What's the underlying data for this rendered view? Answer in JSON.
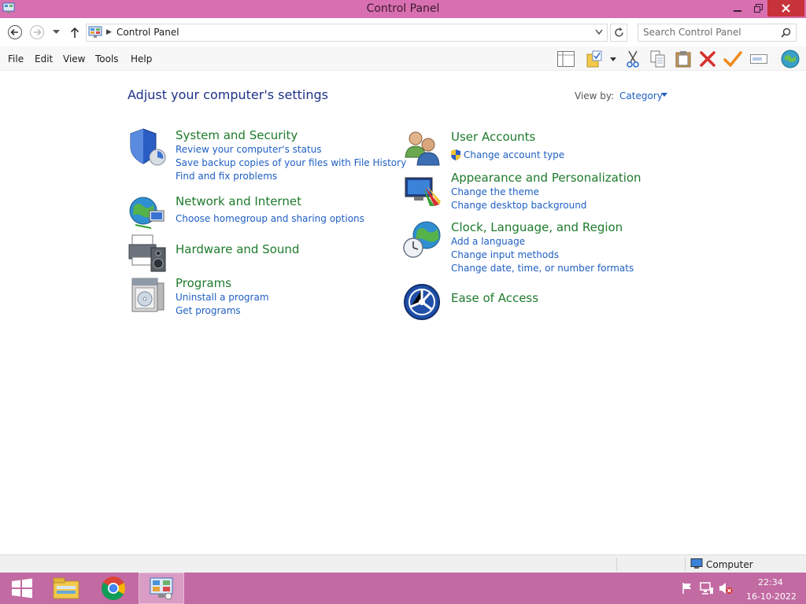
{
  "window": {
    "title": "Control Panel",
    "title_bar_color": "#d86fb0"
  },
  "address_bar": {
    "path": "Control Panel",
    "search_placeholder": "Search Control Panel"
  },
  "menu": {
    "items": [
      "File",
      "Edit",
      "View",
      "Tools",
      "Help"
    ]
  },
  "toolbar": {
    "icons": [
      "layout-pane-icon",
      "properties-folder-icon",
      "cut-icon",
      "copy-icon",
      "paste-icon",
      "delete-icon",
      "check-icon",
      "rename-icon",
      "globe-icon"
    ]
  },
  "content": {
    "heading": "Adjust your computer's settings",
    "view_by_label": "View by:",
    "view_by_value": "Category",
    "link_color": "#1e5fc4",
    "title_color": "#1e7a2c",
    "categories": [
      {
        "title": "System and Security",
        "icon": "shield-icon",
        "links": [
          "Review your computer's status",
          "Save backup copies of your files with File History",
          "Find and fix problems"
        ]
      },
      {
        "title": "Network and Internet",
        "icon": "network-globe-icon",
        "links": [
          "Choose homegroup and sharing options"
        ]
      },
      {
        "title": "Hardware and Sound",
        "icon": "printer-speaker-icon",
        "links": []
      },
      {
        "title": "Programs",
        "icon": "programs-box-icon",
        "links": [
          "Uninstall a program",
          "Get programs"
        ]
      },
      {
        "title": "User Accounts",
        "icon": "users-icon",
        "links": [
          "Change account type"
        ]
      },
      {
        "title": "Appearance and Personalization",
        "icon": "monitor-paint-icon",
        "links": [
          "Change the theme",
          "Change desktop background"
        ]
      },
      {
        "title": "Clock, Language, and Region",
        "icon": "clock-globe-icon",
        "links": [
          "Add a language",
          "Change input methods",
          "Change date, time, or number formats"
        ]
      },
      {
        "title": "Ease of Access",
        "icon": "ease-of-access-icon",
        "links": []
      }
    ]
  },
  "status_bar": {
    "location": "Computer"
  },
  "taskbar": {
    "apps": [
      "windows-start-icon",
      "file-explorer-icon",
      "chrome-icon",
      "control-panel-icon"
    ],
    "active_app": "control-panel-icon",
    "tray_icons": [
      "action-center-flag-icon",
      "network-icon",
      "volume-muted-icon"
    ],
    "time": "22:34",
    "date": "16-10-2022",
    "color": "#c26aa2"
  }
}
